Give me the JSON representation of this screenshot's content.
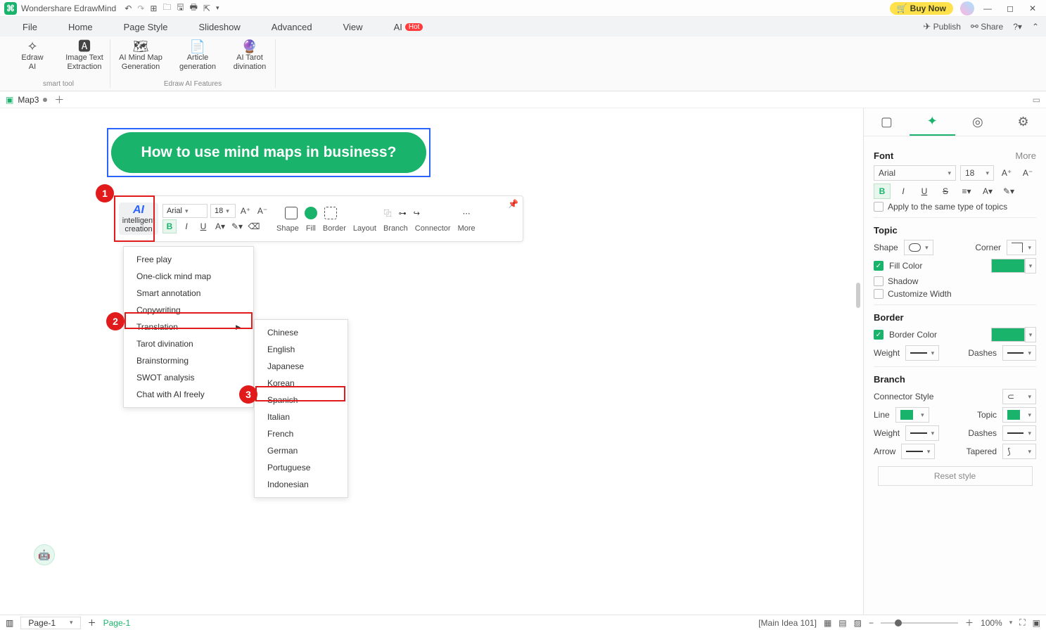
{
  "app": {
    "title": "Wondershare EdrawMind",
    "buy": "Buy Now"
  },
  "menubar": {
    "items": [
      "File",
      "Home",
      "Page Style",
      "Slideshow",
      "Advanced",
      "View"
    ],
    "ai": "AI",
    "hot": "Hot",
    "publish": "Publish",
    "share": "Share"
  },
  "ribbon": {
    "group1_label": "smart tool",
    "group2_label": "Edraw AI Features",
    "btns": {
      "edraw_ai": "Edraw\nAI",
      "image_text": "Image Text\nExtraction",
      "mind_map": "AI Mind Map\nGeneration",
      "article": "Article\ngeneration",
      "tarot": "AI Tarot\ndivination"
    }
  },
  "doctab": {
    "name": "Map3"
  },
  "topic_text": "How to use mind maps in business?",
  "floatbar": {
    "ai1": "intelligent",
    "ai2": "creation",
    "font_name": "Arial",
    "font_size": "18",
    "labels": {
      "shape": "Shape",
      "fill": "Fill",
      "border": "Border",
      "layout": "Layout",
      "branch": "Branch",
      "connector": "Connector",
      "more": "More"
    }
  },
  "dropdown1": [
    "Free play",
    "One-click mind map",
    "Smart annotation",
    "Copywriting",
    "Translation",
    "Tarot divination",
    "Brainstorming",
    "SWOT analysis",
    "Chat with AI freely"
  ],
  "dropdown2": [
    "Chinese",
    "English",
    "Japanese",
    "Korean",
    "Spanish",
    "Italian",
    "French",
    "German",
    "Portuguese",
    "Indonesian"
  ],
  "annotations": {
    "a1": "1",
    "a2": "2",
    "a3": "3"
  },
  "panel": {
    "font_title": "Font",
    "more": "More",
    "font_name": "Arial",
    "font_size": "18",
    "apply_same": "Apply to the same type of topics",
    "topic_title": "Topic",
    "shape": "Shape",
    "corner": "Corner",
    "fill_color": "Fill Color",
    "shadow": "Shadow",
    "custom_width": "Customize Width",
    "border_title": "Border",
    "border_color": "Border Color",
    "weight": "Weight",
    "dashes": "Dashes",
    "branch_title": "Branch",
    "connector_style": "Connector Style",
    "line": "Line",
    "topic": "Topic",
    "arrow": "Arrow",
    "tapered": "Tapered",
    "reset": "Reset style"
  },
  "status": {
    "page_sel": "Page-1",
    "page_tab": "Page-1",
    "hint": "[Main Idea 101]",
    "zoom": "100%"
  }
}
